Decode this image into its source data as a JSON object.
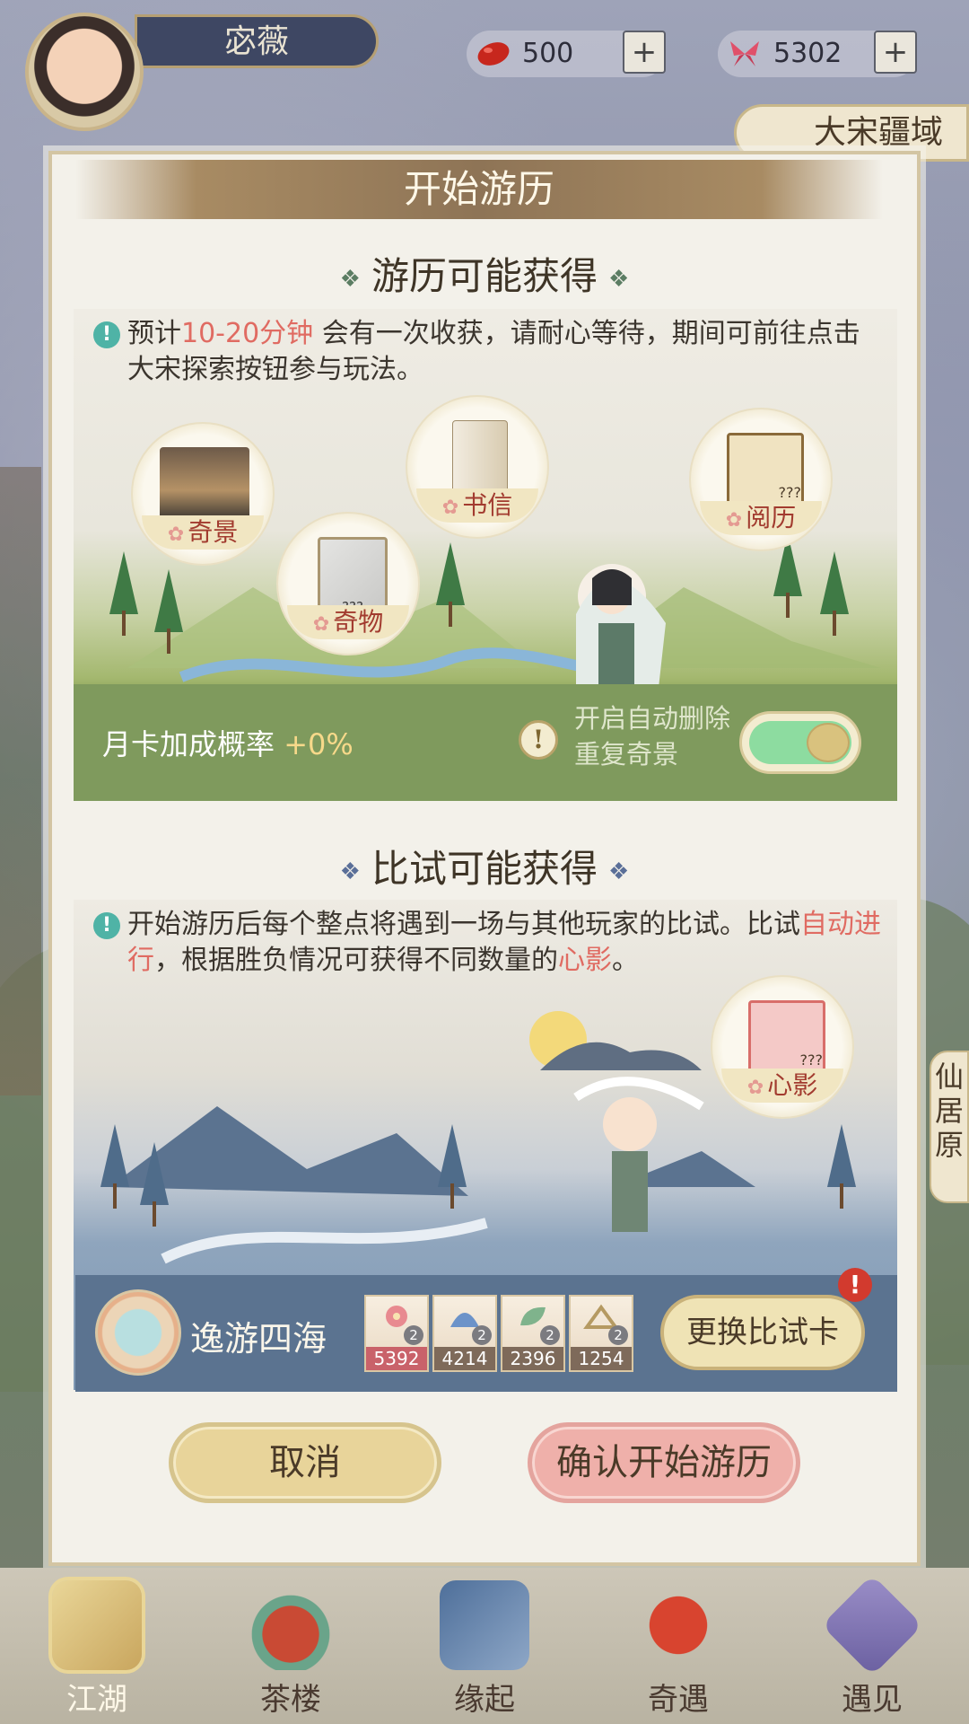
{
  "header": {
    "player_name": "宓薇",
    "resources": [
      {
        "icon": "red-bean-icon",
        "value": "500"
      },
      {
        "icon": "butterfly-icon",
        "value": "5302"
      }
    ],
    "plus_label": "+",
    "region": "大宋疆域"
  },
  "dialog": {
    "title": "开始游历",
    "travel": {
      "heading": "游历可能获得",
      "notice_pre": "预计",
      "notice_highlight": "10-20分钟",
      "notice_post": " 会有一次收获，请耐心等待，期间可前往点击大宋探索按钮参与玩法。",
      "rewards": [
        {
          "label": "奇景",
          "icon": "scenery-painting-icon"
        },
        {
          "label": "书信",
          "icon": "letter-scroll-icon"
        },
        {
          "label": "阅历",
          "icon": "experience-card-icon",
          "unknown": "???"
        },
        {
          "label": "奇物",
          "icon": "curio-frame-icon",
          "unknown": "???"
        }
      ],
      "monthly_bonus_label": "月卡加成概率",
      "monthly_bonus_value": "+0%",
      "auto_delete_label": "开启自动删除重复奇景",
      "auto_delete_on": true
    },
    "duel": {
      "heading": "比试可能获得",
      "notice_pre": "开始游历后每个整点将遇到一场与其他玩家的比试。比试",
      "notice_highlight1": "自动进行",
      "notice_mid": "，根据胜负情况可获得不同数量的",
      "notice_highlight2": "心影",
      "notice_end": "。",
      "reward": {
        "label": "心影",
        "icon": "heart-shadow-icon",
        "unknown": "???"
      },
      "team_name": "逸游四海",
      "cards": [
        {
          "count": "2",
          "value": "5392",
          "icon": "plum-blossom-icon"
        },
        {
          "count": "2",
          "value": "4214",
          "icon": "fan-icon"
        },
        {
          "count": "2",
          "value": "2396",
          "icon": "leaf-icon"
        },
        {
          "count": "2",
          "value": "1254",
          "icon": "mountain-icon"
        }
      ],
      "change_button": "更换比试卡",
      "alert_badge": "!"
    },
    "cancel_button": "取消",
    "confirm_button": "确认开始游历"
  },
  "side_tab": "仙居原",
  "nav": [
    {
      "label": "江湖",
      "icon": "map-scroll-icon",
      "active": true
    },
    {
      "label": "茶楼",
      "icon": "teacup-icon",
      "active": false
    },
    {
      "label": "缘起",
      "icon": "book-icon",
      "active": false
    },
    {
      "label": "奇遇",
      "icon": "maple-leaf-icon",
      "active": false
    },
    {
      "label": "遇见",
      "icon": "crystal-icon",
      "active": false
    }
  ],
  "colors": {
    "accent_red": "#e06b62",
    "travel_bar": "#7f9a5d",
    "duel_bar": "#5b7390",
    "toggle_on": "#8ddca0"
  }
}
